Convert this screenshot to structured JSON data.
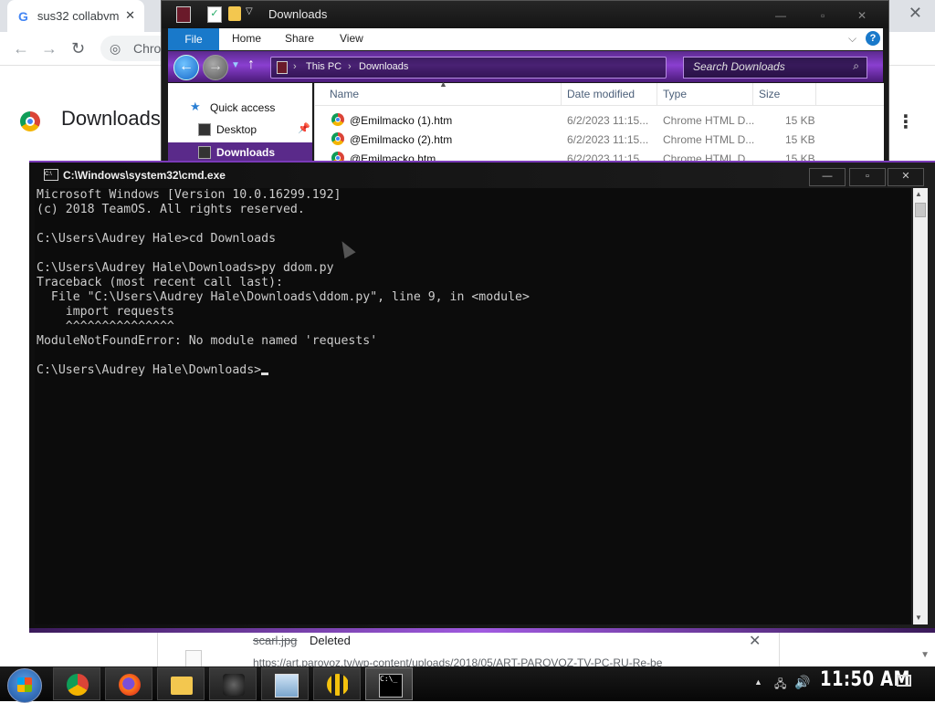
{
  "chrome": {
    "tab_title": "sus32 collabvm",
    "tab_close": "✕",
    "window_close": "✕",
    "omnibox_text": "Chrom",
    "page_title": "Downloads",
    "menu": "⋮",
    "download_item": {
      "file": "scarl.jpg",
      "status": "Deleted",
      "url": "https://art.parovoz.tv/wp-content/uploads/2018/05/ART-PAROVOZ-TV-PC-RU-Re-be",
      "close": "✕"
    }
  },
  "explorer": {
    "title": "Downloads",
    "ribbon_tabs": [
      "File",
      "Home",
      "Share",
      "View"
    ],
    "breadcrumb": [
      "This PC",
      "Downloads"
    ],
    "search_placeholder": "Search Downloads",
    "nav": {
      "quick_access": "Quick access",
      "desktop": "Desktop",
      "downloads": "Downloads"
    },
    "columns": [
      "Name",
      "Date modified",
      "Type",
      "Size"
    ],
    "files": [
      {
        "name": "@Emilmacko (1).htm",
        "date": "6/2/2023 11:15...",
        "type": "Chrome HTML D...",
        "size": "15 KB"
      },
      {
        "name": "@Emilmacko (2).htm",
        "date": "6/2/2023 11:15...",
        "type": "Chrome HTML D...",
        "size": "15 KB"
      },
      {
        "name": "@Emilmacko.htm",
        "date": "6/2/2023 11:15...",
        "type": "Chrome HTML D...",
        "size": "15 KB"
      }
    ]
  },
  "cmd": {
    "title": "C:\\Windows\\system32\\cmd.exe",
    "output": "Microsoft Windows [Version 10.0.16299.192]\n(c) 2018 TeamOS. All rights reserved.\n\nC:\\Users\\Audrey Hale>cd Downloads\n\nC:\\Users\\Audrey Hale\\Downloads>py ddom.py\nTraceback (most recent call last):\n  File \"C:\\Users\\Audrey Hale\\Downloads\\ddom.py\", line 9, in <module>\n    import requests\n    ^^^^^^^^^^^^^^^\nModuleNotFoundError: No module named 'requests'\n\n",
    "prompt": "C:\\Users\\Audrey Hale\\Downloads>"
  },
  "taskbar": {
    "clock": "11:50 AM",
    "apps": [
      "chrome-icon",
      "firefox-icon",
      "file-explorer-icon",
      "figure-app-icon",
      "monitor-app-icon",
      "bee-app-icon",
      "cmd-icon"
    ]
  }
}
